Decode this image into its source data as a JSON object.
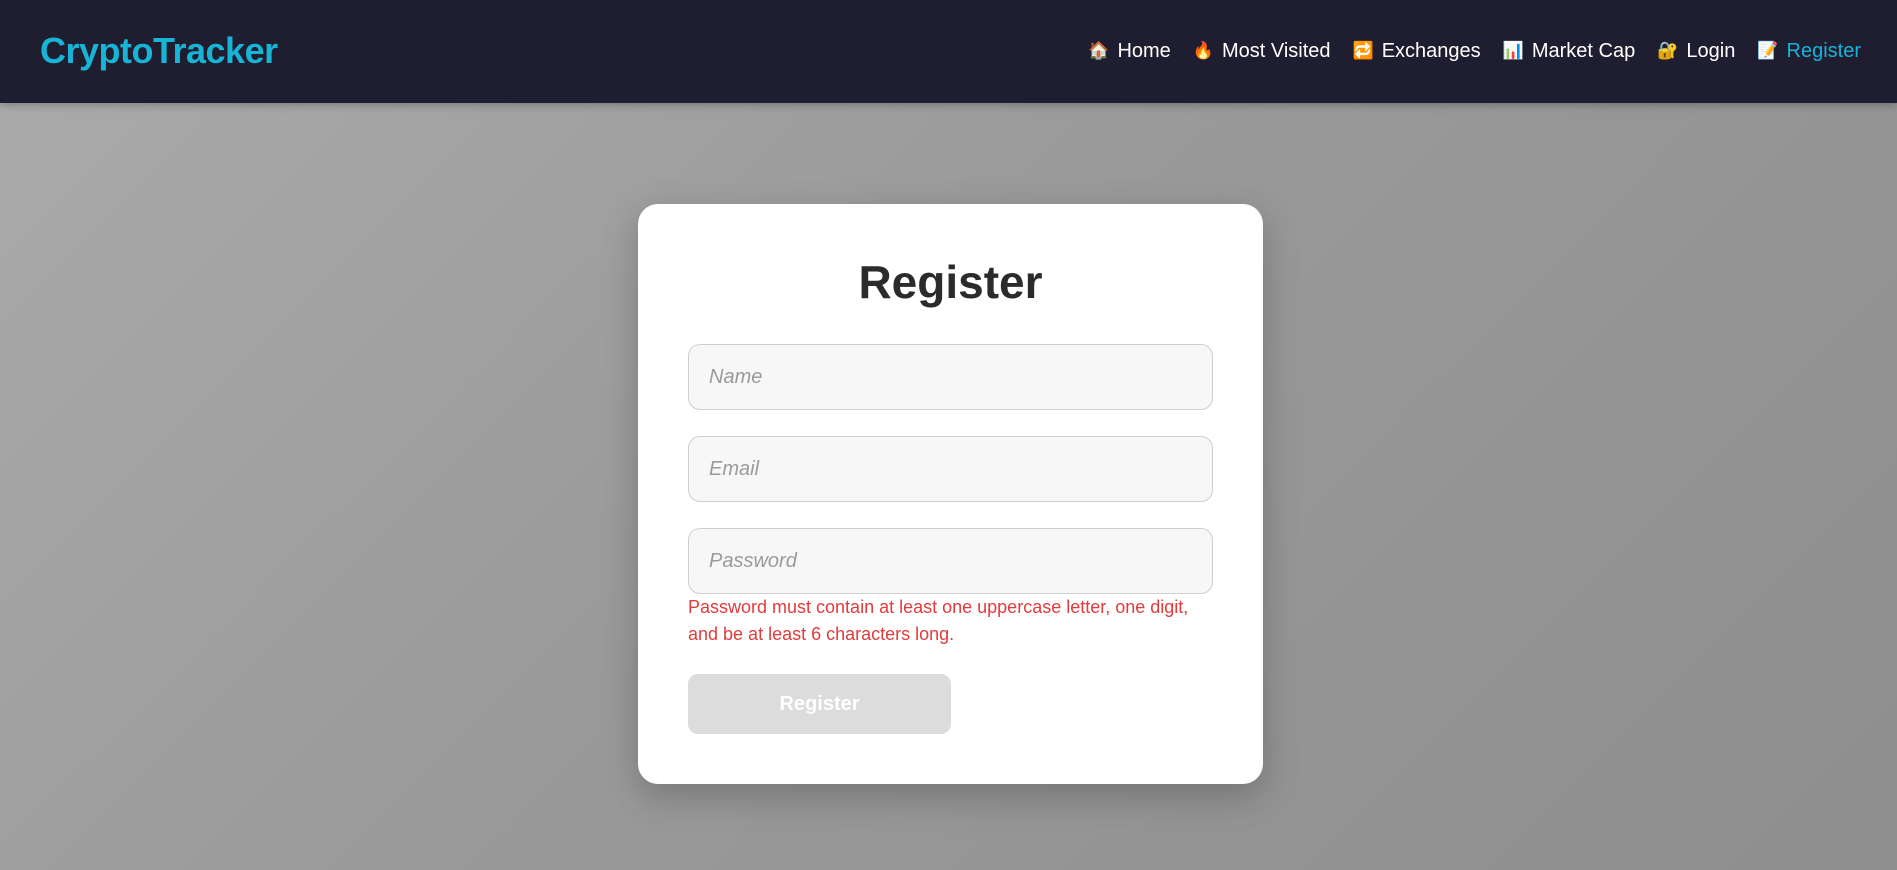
{
  "brand": "CryptoTracker",
  "nav": {
    "items": [
      {
        "label": "Home",
        "icon": "🏠",
        "icon_name": "home-icon"
      },
      {
        "label": "Most Visited",
        "icon": "🔥",
        "icon_name": "fire-icon"
      },
      {
        "label": "Exchanges",
        "icon": "🔁",
        "icon_name": "exchange-icon"
      },
      {
        "label": "Market Cap",
        "icon": "📊",
        "icon_name": "bar-chart-icon"
      },
      {
        "label": "Login",
        "icon": "🔐",
        "icon_name": "lock-icon"
      },
      {
        "label": "Register",
        "icon": "📝",
        "icon_name": "memo-icon",
        "active": true
      }
    ]
  },
  "form": {
    "title": "Register",
    "name_placeholder": "Name",
    "email_placeholder": "Email",
    "password_placeholder": "Password",
    "password_error": "Password must contain at least one uppercase letter, one digit, and be at least 6 characters long.",
    "submit_label": "Register"
  },
  "colors": {
    "navbar_bg": "#1f1e30",
    "accent": "#18b4d6",
    "error": "#e23b3b",
    "button_disabled": "#dcdcdc"
  }
}
